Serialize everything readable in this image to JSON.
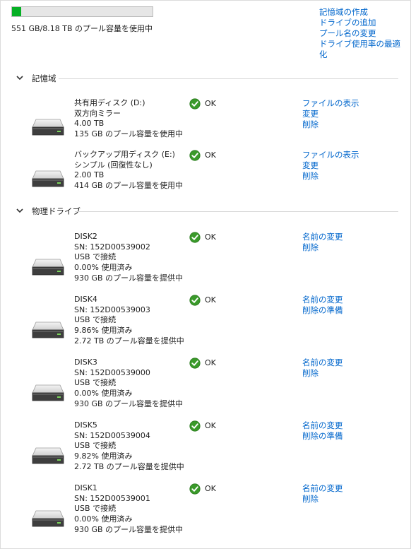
{
  "pool": {
    "used_fraction": 0.066,
    "usage_text": "551 GB/8.18 TB のプール容量を使用中"
  },
  "top_actions": [
    "記憶域の作成",
    "ドライブの追加",
    "プール名の変更",
    "ドライブ使用率の最適化"
  ],
  "sections": {
    "storage_spaces": {
      "label": "記憶域",
      "items": [
        {
          "lines": [
            "共有用ディスク (D:)",
            "双方向ミラー",
            "4.00 TB",
            "135 GB のプール容量を使用中"
          ],
          "status": "OK",
          "actions": [
            "ファイルの表示",
            "変更",
            "削除"
          ]
        },
        {
          "lines": [
            "バックアップ用ディスク (E:)",
            "シンプル (回復性なし)",
            "2.00 TB",
            "414 GB のプール容量を使用中"
          ],
          "status": "OK",
          "actions": [
            "ファイルの表示",
            "変更",
            "削除"
          ]
        }
      ]
    },
    "physical_drives": {
      "label": "物理ドライブ",
      "items": [
        {
          "lines": [
            "DISK2",
            "SN: 152D00539002",
            "USB で接続",
            "0.00% 使用済み",
            "930 GB のプール容量を提供中"
          ],
          "status": "OK",
          "actions": [
            "名前の変更",
            "削除"
          ]
        },
        {
          "lines": [
            "DISK4",
            "SN: 152D00539003",
            "USB で接続",
            "9.86% 使用済み",
            "2.72 TB のプール容量を提供中"
          ],
          "status": "OK",
          "actions": [
            "名前の変更",
            "削除の準備"
          ]
        },
        {
          "lines": [
            "DISK3",
            "SN: 152D00539000",
            "USB で接続",
            "0.00% 使用済み",
            "930 GB のプール容量を提供中"
          ],
          "status": "OK",
          "actions": [
            "名前の変更",
            "削除"
          ]
        },
        {
          "lines": [
            "DISK5",
            "SN: 152D00539004",
            "USB で接続",
            "9.82% 使用済み",
            "2.72 TB のプール容量を提供中"
          ],
          "status": "OK",
          "actions": [
            "名前の変更",
            "削除の準備"
          ]
        },
        {
          "lines": [
            "DISK1",
            "SN: 152D00539001",
            "USB で接続",
            "0.00% 使用済み",
            "930 GB のプール容量を提供中"
          ],
          "status": "OK",
          "actions": [
            "名前の変更",
            "削除"
          ]
        }
      ]
    }
  },
  "icons": {
    "drive": "hard-drive-icon",
    "status": "check-circle-icon",
    "collapse": "chevron-down-icon"
  },
  "colors": {
    "progress_fill": "#06b025",
    "link": "#0066cc",
    "ok_green": "#3a9a2a"
  }
}
